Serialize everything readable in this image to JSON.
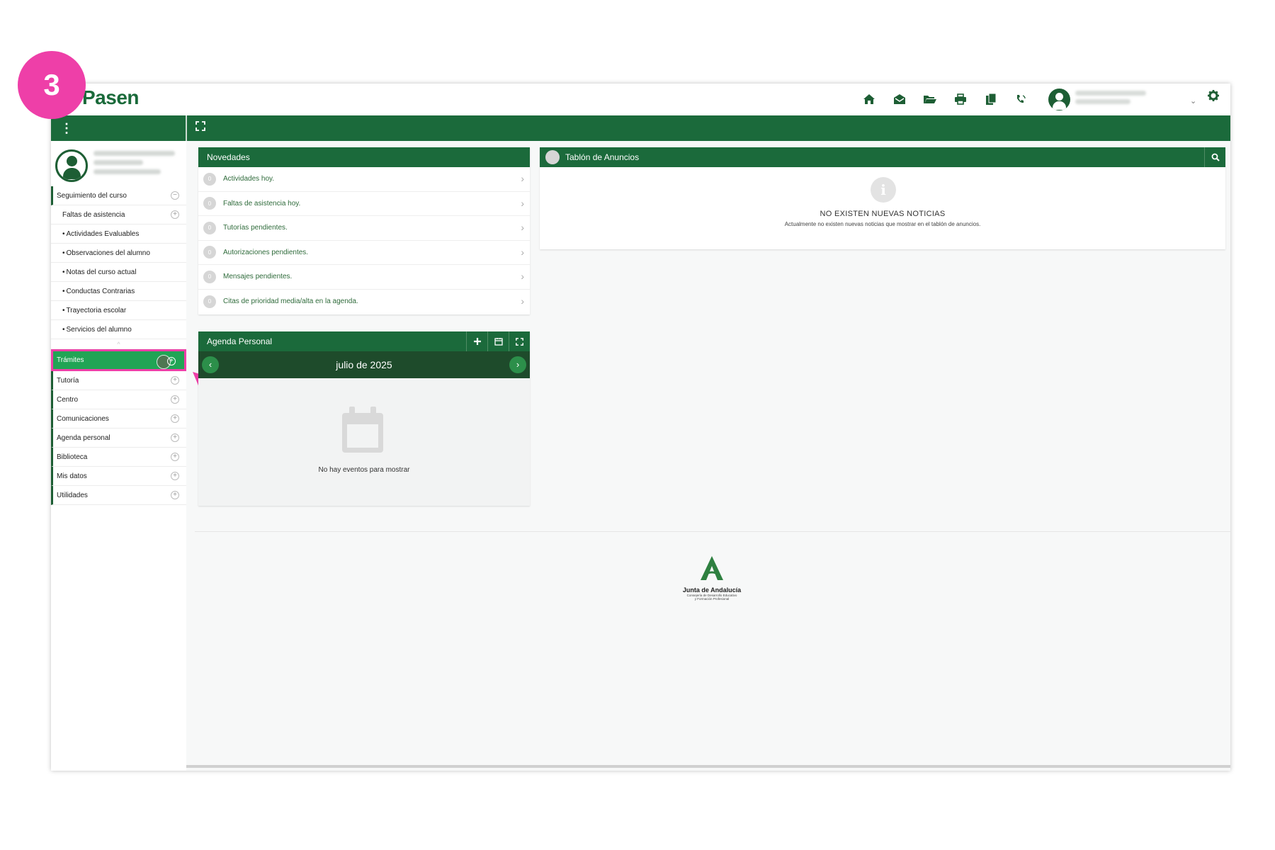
{
  "step_badge": "3",
  "app": {
    "logo": "Pasen"
  },
  "topbar": {
    "icons": [
      "home-icon",
      "mail-icon",
      "folder-open-icon",
      "print-icon",
      "documents-icon",
      "phone-icon"
    ],
    "caret": "⌄"
  },
  "sidebar": {
    "seguimiento": {
      "label": "Seguimiento del curso",
      "items": [
        {
          "label": "Faltas de asistencia",
          "has_plus": true
        },
        {
          "label": "Actividades Evaluables"
        },
        {
          "label": "Observaciones del alumno"
        },
        {
          "label": "Notas del curso actual"
        },
        {
          "label": "Conductas Contrarias"
        },
        {
          "label": "Trayectoria escolar"
        },
        {
          "label": "Servicios del alumno"
        }
      ]
    },
    "main_items": [
      {
        "label": "Trámites"
      },
      {
        "label": "Tutoría"
      },
      {
        "label": "Centro"
      },
      {
        "label": "Comunicaciones"
      },
      {
        "label": "Agenda personal"
      },
      {
        "label": "Biblioteca"
      },
      {
        "label": "Mis datos"
      },
      {
        "label": "Utilidades"
      }
    ]
  },
  "novedades": {
    "title": "Novedades",
    "items": [
      {
        "count": "0",
        "label": "Actividades hoy."
      },
      {
        "count": "0",
        "label": "Faltas de asistencia hoy."
      },
      {
        "count": "0",
        "label": "Tutorías pendientes."
      },
      {
        "count": "0",
        "label": "Autorizaciones pendientes."
      },
      {
        "count": "0",
        "label": "Mensajes pendientes."
      },
      {
        "count": "0",
        "label": "Citas de prioridad media/alta en la agenda."
      }
    ]
  },
  "agenda": {
    "title": "Agenda Personal",
    "month": "julio de 2025",
    "empty": "No hay eventos para mostrar"
  },
  "tablon": {
    "title": "Tablón de Anuncios",
    "badge": "0",
    "no_news_title": "NO EXISTEN NUEVAS NOTICIAS",
    "no_news_sub": "Actualmente no existen nuevas noticias que mostrar en el tablón de anuncios."
  },
  "footer": {
    "logo_name": "Junta de Andalucía",
    "logo_sub1": "Consejería de Desarrollo Educativo",
    "logo_sub2": "y Formación Profesional"
  },
  "colors": {
    "brand_green": "#1b6a3b",
    "active_green": "#21a455",
    "highlight_pink": "#ee3fa8"
  }
}
